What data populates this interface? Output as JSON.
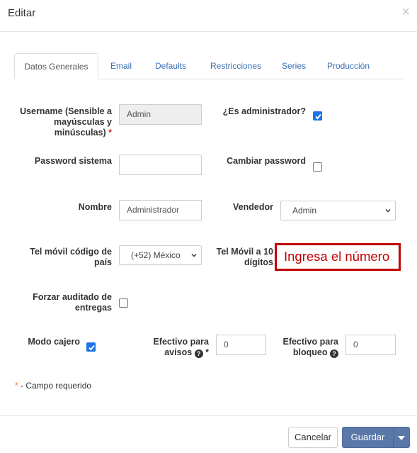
{
  "dialog": {
    "title": "Editar",
    "close_symbol": "×"
  },
  "tabs": [
    {
      "label": "Datos Generales",
      "active": true
    },
    {
      "label": "Email",
      "active": false
    },
    {
      "label": "Defaults",
      "active": false
    },
    {
      "label": "Restricciones",
      "active": false
    },
    {
      "label": "Series",
      "active": false
    },
    {
      "label": "Producción",
      "active": false
    }
  ],
  "form": {
    "username": {
      "label_l1": "Username (Sensible a",
      "label_l2": "mayúsculas y",
      "label_l3": "minúsculas)",
      "required_mark": "*",
      "value": "Admin"
    },
    "es_admin": {
      "label": "¿Es administrador?",
      "checked": true
    },
    "password": {
      "label": "Password sistema",
      "value": ""
    },
    "cambiar_password": {
      "label": "Cambiar password",
      "checked": false
    },
    "nombre": {
      "label": "Nombre",
      "value": "Administrador"
    },
    "vendedor": {
      "label": "Vendedor",
      "selected": "Admin"
    },
    "tel_codigo": {
      "label_l1": "Tel móvil código de",
      "label_l2": "país",
      "selected": "(+52) México"
    },
    "tel_movil": {
      "label_l1": "Tel Móvil a 10",
      "label_l2": "dígitos",
      "annotation": "Ingresa el número"
    },
    "forzar_auditado": {
      "label_l1": "Forzar auditado de",
      "label_l2": "entregas",
      "checked": false
    },
    "modo_cajero": {
      "label": "Modo cajero",
      "checked": true
    },
    "efectivo_avisos": {
      "label_l1": "Efectivo para",
      "label_l2": "avisos",
      "help_symbol": "?",
      "required_mark": "*",
      "value": "0"
    },
    "efectivo_bloqueo": {
      "label_l1": "Efectivo para",
      "label_l2": "bloqueo",
      "help_symbol": "?",
      "value": "0"
    }
  },
  "required_note": {
    "mark": "*",
    "text": " - Campo requerido"
  },
  "footer": {
    "cancel_label": "Cancelar",
    "save_label": "Guardar"
  },
  "colors": {
    "accent": "#5a78a8",
    "highlight": "#c00000",
    "checkbox": "#1a73e8"
  }
}
